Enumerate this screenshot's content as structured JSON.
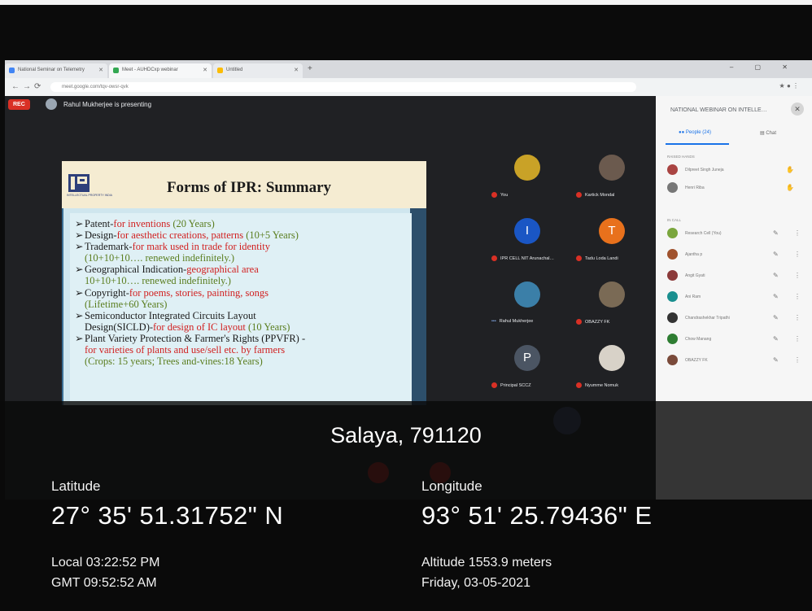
{
  "browser": {
    "tabs": [
      {
        "label": "National Seminar on Telemetry",
        "color": "#4285f4"
      },
      {
        "label": "Meet - AUHDCxp webinar",
        "color": "#34a853"
      },
      {
        "label": "Untitled",
        "color": "#fbbc04"
      }
    ],
    "new_tab": "+",
    "url": "meet.google.com/tqv-owsr-qvk"
  },
  "meet": {
    "rec_label": "REC",
    "presenting_text": "Rahul Mukherjee is presenting"
  },
  "slide": {
    "title": "Forms of IPR: Summary",
    "logo_caption": "INTELLECTUAL PROPERTY INDIA",
    "bullets": [
      {
        "head": "Patent-",
        "body": "for inventions",
        "years": " (20 Years)"
      },
      {
        "head": "Design-",
        "body": "for aesthetic creations, patterns",
        "years": " (10+5 Years)"
      },
      {
        "head": "Trademark-",
        "body": "for mark used in trade for identity",
        "cont": "(10+10+10…. renewed indefinitely.)"
      },
      {
        "head": "Geographical Indication-",
        "body": "geographical area",
        "cont": "10+10+10…. renewed indefinitely.)"
      },
      {
        "head": "Copyright-",
        "body": "for poems, stories, painting, songs",
        "cont": "(Lifetime+60 Years)"
      },
      {
        "head": "Semiconductor Integrated Circuits Layout",
        "cont_head": "Design(SICLD)-",
        "cont_body": "for design of IC layout",
        "cont_years": " (10 Years)"
      },
      {
        "head": "Plant Variety Protection & Farmer's Rights (PPVFR) -",
        "cont": "for varieties of plants and use/sell etc. by farmers",
        "cont2": "(Crops: 15 years; Trees and-vines:18 Years)"
      }
    ]
  },
  "participants": [
    {
      "name": "You",
      "initial": "",
      "color": "#c9a227"
    },
    {
      "name": "Kartick Mondal",
      "initial": "",
      "color": "#6b5a4e"
    },
    {
      "name": "IPR CELL NIT Arunachal…",
      "initial": "I",
      "color": "#1a56c4"
    },
    {
      "name": "Tadu Loda Landi",
      "initial": "T",
      "color": "#e8711c"
    },
    {
      "name": "Rahul Mukherjee",
      "initial": "",
      "color": "#3b7fa8"
    },
    {
      "name": "OBAZZY FK",
      "initial": "",
      "color": "#7a6a55"
    },
    {
      "name": "Principal SCCZ",
      "initial": "P",
      "color": "#4b5563"
    },
    {
      "name": "Nyumme Nomuk",
      "initial": "",
      "color": "#d8d2c8"
    }
  ],
  "panel": {
    "title": "NATIONAL WEBINAR ON INTELLE…",
    "tab_people": "People (24)",
    "tab_chat": "Chat",
    "raised_hands": "RAISED HANDS",
    "in_call": "IN CALL",
    "raised": [
      {
        "name": "Dilpreet Singh Juneja",
        "color": "#a94442"
      },
      {
        "name": "Henri Riba",
        "color": "#777"
      }
    ],
    "people": [
      {
        "name": "Research Cell (You)",
        "color": "#7aa63d"
      },
      {
        "name": "Ajantha p",
        "color": "#a0522d"
      },
      {
        "name": "Angit Gyati",
        "color": "#8b3a3a"
      },
      {
        "name": "Ani Ram",
        "color": "#1a8f8f"
      },
      {
        "name": "Chandrashekhar Tripathi",
        "color": "#333"
      },
      {
        "name": "Chow Manang",
        "color": "#2e7d32"
      },
      {
        "name": "OBAZZY FK",
        "color": "#7a4a3a"
      }
    ]
  },
  "location": {
    "place": "Salaya, 791120",
    "latitude_label": "Latitude",
    "latitude_value": "27° 35' 51.31752\" N",
    "longitude_label": "Longitude",
    "longitude_value": "93° 51' 25.79436\" E",
    "local_time": "Local 03:22:52 PM",
    "gmt_time": "GMT 09:52:52 AM",
    "altitude": "Altitude 1553.9 meters",
    "date": "Friday, 03-05-2021"
  }
}
